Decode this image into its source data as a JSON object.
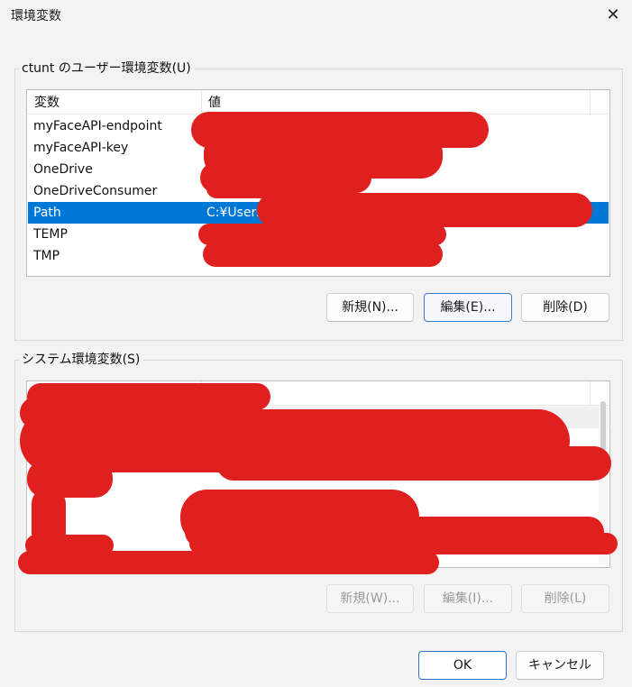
{
  "window": {
    "title": "環境変数",
    "close_icon": "close-icon"
  },
  "user_group": {
    "title": "ctunt のユーザー環境変数(U)",
    "columns": [
      "変数",
      "値"
    ],
    "rows": [
      {
        "name": "myFaceAPI-endpoint",
        "value": ""
      },
      {
        "name": "myFaceAPI-key",
        "value": ""
      },
      {
        "name": "OneDrive",
        "value": ""
      },
      {
        "name": "OneDriveConsumer",
        "value": ""
      },
      {
        "name": "Path",
        "value": "C:¥Users"
      },
      {
        "name": "TEMP",
        "value": ""
      },
      {
        "name": "TMP",
        "value": ""
      }
    ],
    "selected_index": 4,
    "buttons": {
      "new": "新規(N)...",
      "edit": "編集(E)...",
      "delete": "削除(D)"
    }
  },
  "system_group": {
    "title": "システム環境変数(S)",
    "buttons": {
      "new": "新規(W)...",
      "edit": "編集(I)...",
      "delete": "削除(L)"
    }
  },
  "footer": {
    "ok": "OK",
    "cancel": "キャンセル"
  },
  "colors": {
    "selection": "#0078d7",
    "redaction": "#e01f1f",
    "background": "#f3f3f3"
  }
}
